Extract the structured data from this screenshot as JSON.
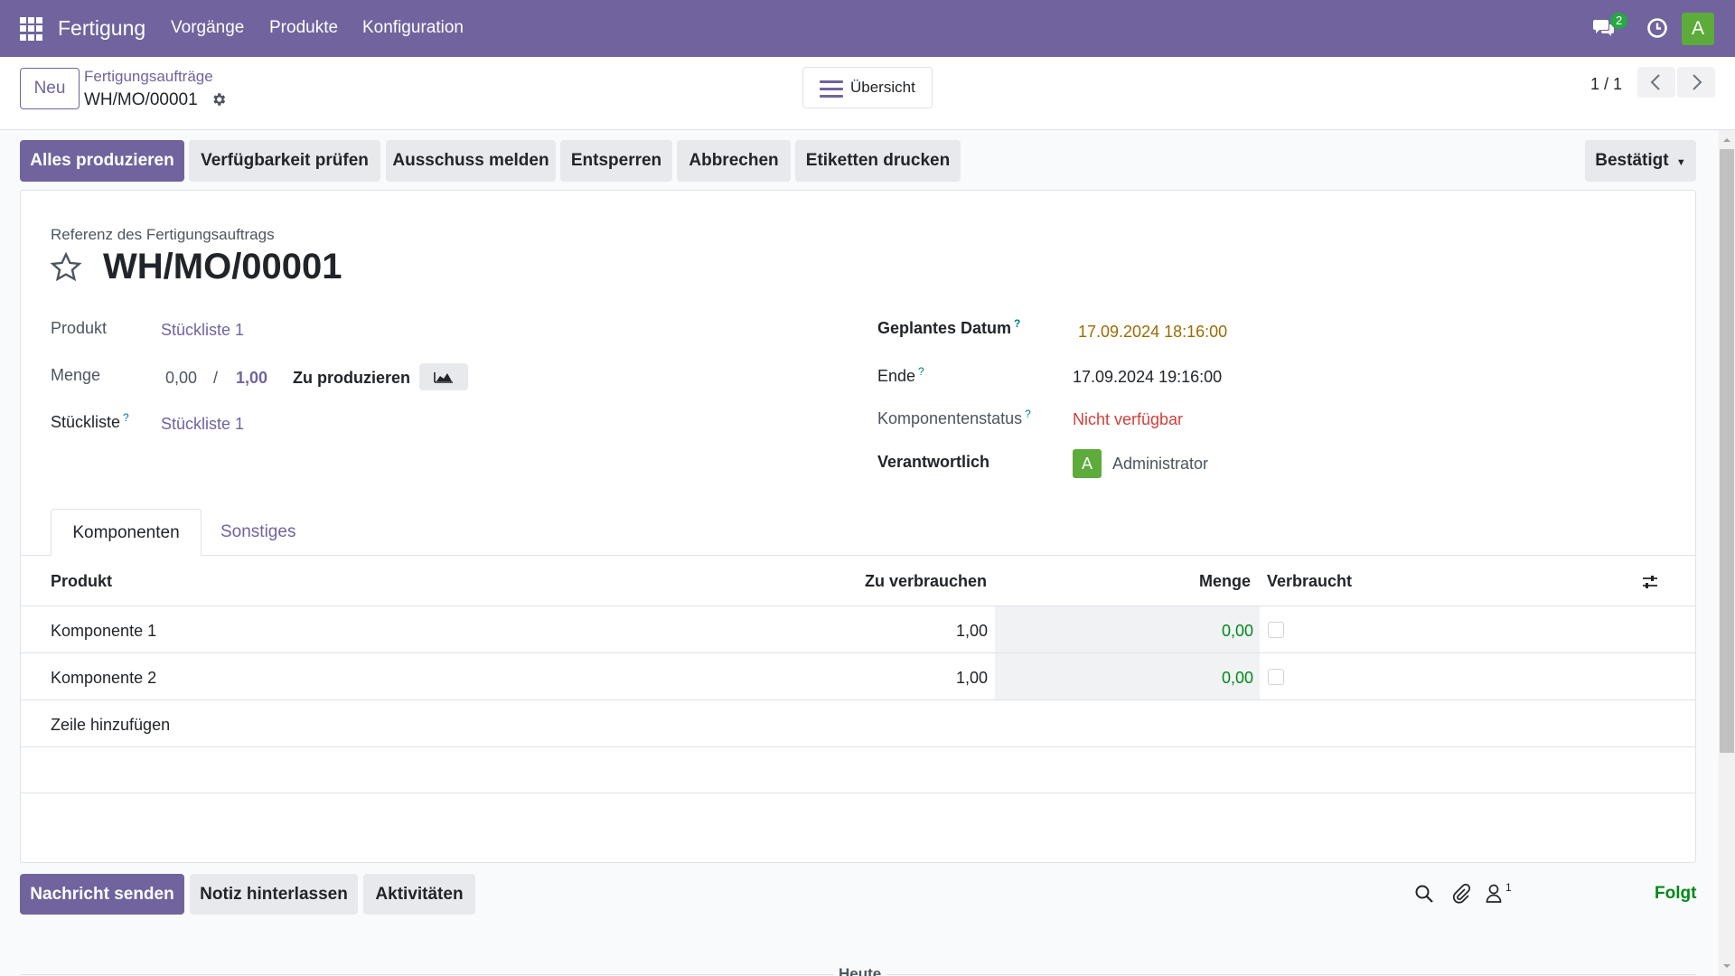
{
  "navbar": {
    "app_name": "Fertigung",
    "menu": [
      "Vorgänge",
      "Produkte",
      "Konfiguration"
    ],
    "chat_count": "2",
    "user_initial": "A"
  },
  "control": {
    "new_label": "Neu",
    "breadcrumb_parent": "Fertigungsaufträge",
    "breadcrumb_current": "WH/MO/00001",
    "overview_label": "Übersicht",
    "pager": "1 / 1"
  },
  "statusbar": {
    "buttons": [
      "Alles produzieren",
      "Verfügbarkeit prüfen",
      "Ausschuss melden",
      "Entsperren",
      "Abbrechen",
      "Etiketten drucken"
    ],
    "state": "Bestätigt"
  },
  "form": {
    "ref_label": "Referenz des Fertigungsauftrags",
    "ref": "WH/MO/00001",
    "product_label": "Produkt",
    "product": "Stückliste 1",
    "qty_label": "Menge",
    "qty_produced": "0,00",
    "qty_sep": "/",
    "qty_total": "1,00",
    "qty_to_produce": "Zu produzieren",
    "bom_label": "Stückliste",
    "bom": "Stückliste 1",
    "planned_label": "Geplantes Datum",
    "planned": "17.09.2024 18:16:00",
    "end_label": "Ende",
    "end": "17.09.2024 19:16:00",
    "component_status_label": "Komponentenstatus",
    "component_status": "Nicht verfügbar",
    "responsible_label": "Verantwortlich",
    "responsible": "Administrator",
    "responsible_initial": "A",
    "help_mark": "?"
  },
  "tabs": [
    "Komponenten",
    "Sonstiges"
  ],
  "table": {
    "headers": [
      "Produkt",
      "Zu verbrauchen",
      "Menge",
      "Verbraucht"
    ],
    "rows": [
      {
        "product": "Komponente 1",
        "to_consume": "1,00",
        "qty": "0,00",
        "consumed": false
      },
      {
        "product": "Komponente 2",
        "to_consume": "1,00",
        "qty": "0,00",
        "consumed": false
      }
    ],
    "add_line": "Zeile hinzufügen"
  },
  "chatter": {
    "send_message": "Nachricht senden",
    "log_note": "Notiz hinterlassen",
    "activities": "Aktivitäten",
    "follower_count": "1",
    "follow_label": "Folgt",
    "today": "Heute"
  },
  "colors": {
    "brand": "#71639e",
    "success": "#008818",
    "danger": "#d23f3a",
    "warning_date": "#9a6b01"
  }
}
